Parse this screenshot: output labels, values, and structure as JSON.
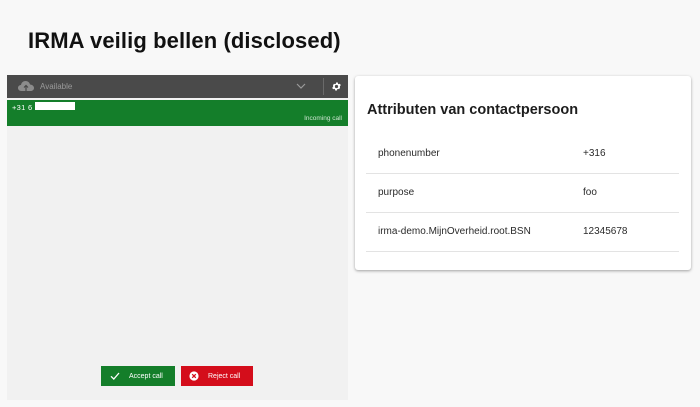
{
  "page": {
    "title": "IRMA veilig bellen (disclosed)"
  },
  "softphone": {
    "status": "Available",
    "status_icon": "cloud-icon",
    "caller_number": "+31 6",
    "incoming_label": "Incoming call",
    "accept_label": "Accept call",
    "reject_label": "Reject call",
    "colors": {
      "bar": "#4a4a4a",
      "incoming": "#147e2a",
      "accept": "#147e2a",
      "reject": "#d40d1b"
    }
  },
  "attributes": {
    "title": "Attributen van contactpersoon",
    "rows": [
      {
        "key": "phonenumber",
        "value": "+316"
      },
      {
        "key": "purpose",
        "value": "foo"
      },
      {
        "key": "irma-demo.MijnOverheid.root.BSN",
        "value": "12345678"
      }
    ]
  }
}
